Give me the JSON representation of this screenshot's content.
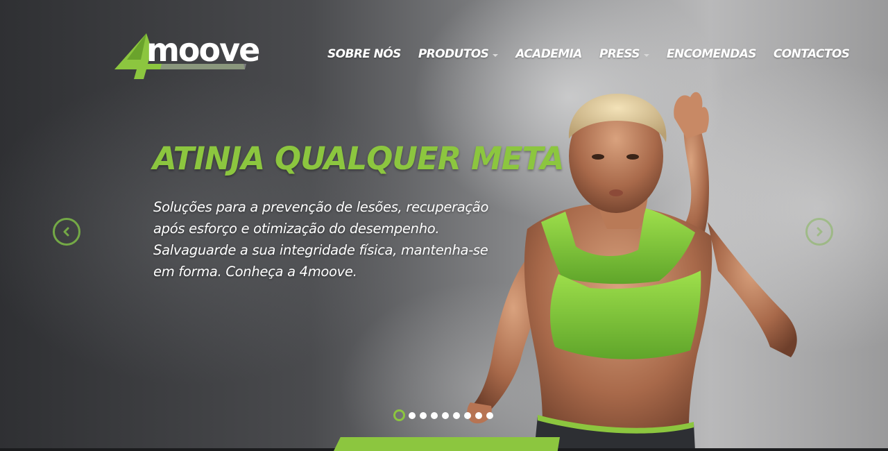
{
  "brand": {
    "name": "4moove",
    "logo_icon": "4moove-logo",
    "colors": {
      "accent": "#8cc63f",
      "text": "#ffffff"
    }
  },
  "nav": {
    "items": [
      {
        "label": "SOBRE NÓS",
        "has_dropdown": false
      },
      {
        "label": "PRODUTOS",
        "has_dropdown": true
      },
      {
        "label": "ACADEMIA",
        "has_dropdown": false
      },
      {
        "label": "PRESS",
        "has_dropdown": true
      },
      {
        "label": "ENCOMENDAS",
        "has_dropdown": false
      },
      {
        "label": "CONTACTOS",
        "has_dropdown": false
      }
    ]
  },
  "slide": {
    "title": "ATINJA QUALQUER META",
    "text": "Soluções para a prevenção de lesões, recuperação após esforço e otimização do desempenho. Salvaguarde a sua integridade física, mantenha-se em forma. Conheça a 4moove."
  },
  "carousel": {
    "prev_icon": "chevron-left-icon",
    "next_icon": "chevron-right-icon",
    "slide_count": 9,
    "active_index": 0
  }
}
